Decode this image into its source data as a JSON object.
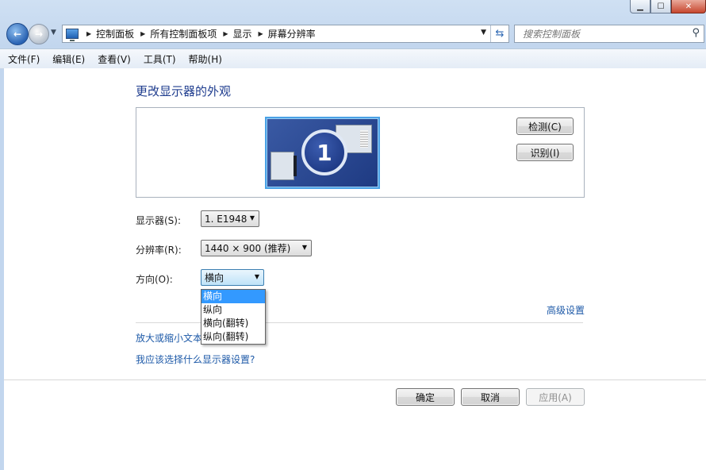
{
  "window": {
    "caption_buttons": [
      "minimize",
      "maximize",
      "close"
    ]
  },
  "address_bar": {
    "breadcrumbs": [
      "控制面板",
      "所有控制面板项",
      "显示",
      "屏幕分辨率"
    ],
    "search_placeholder": "搜索控制面板"
  },
  "menubar": {
    "items": [
      "文件(F)",
      "编辑(E)",
      "查看(V)",
      "工具(T)",
      "帮助(H)"
    ]
  },
  "main": {
    "title": "更改显示器的外观",
    "monitor_number": "1",
    "detect_label": "检测(C)",
    "identify_label": "识别(I)",
    "display_label": "显示器(S):",
    "display_value": "1. E1948",
    "resolution_label": "分辨率(R):",
    "resolution_value": "1440 × 900 (推荐)",
    "orientation_label": "方向(O):",
    "orientation_value": "横向",
    "orientation_options": [
      "横向",
      "纵向",
      "横向(翻转)",
      "纵向(翻转)"
    ],
    "advanced_link": "高级设置",
    "link_text_size": "放大或缩小文本",
    "link_which_settings": "我应该选择什么显示器设置?"
  },
  "footer": {
    "ok_label": "确定",
    "cancel_label": "取消",
    "apply_label": "应用(A)"
  }
}
